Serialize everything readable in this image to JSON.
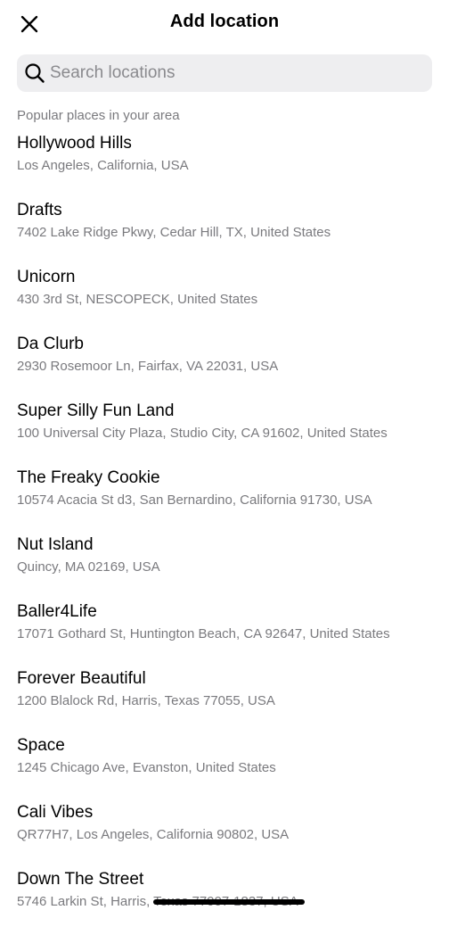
{
  "header": {
    "title": "Add location",
    "close_icon": "close-icon"
  },
  "search": {
    "placeholder": "Search locations",
    "value": "",
    "icon": "search-icon"
  },
  "section": {
    "title": "Popular places in your area"
  },
  "locations": [
    {
      "name": "Hollywood Hills",
      "address": "Los Angeles, California, USA"
    },
    {
      "name": "Drafts",
      "address": "7402 Lake Ridge Pkwy, Cedar Hill, TX, United States"
    },
    {
      "name": "Unicorn",
      "address": "430 3rd St, NESCOPECK, United States"
    },
    {
      "name": "Da Clurb",
      "address": "2930 Rosemoor Ln, Fairfax, VA 22031, USA"
    },
    {
      "name": "Super Silly Fun Land",
      "address": "100 Universal City Plaza, Studio City, CA 91602, United States"
    },
    {
      "name": "The Freaky Cookie",
      "address": "10574 Acacia St d3, San Bernardino, California 91730, USA"
    },
    {
      "name": "Nut Island",
      "address": "Quincy, MA 02169, USA"
    },
    {
      "name": "Baller4Life",
      "address": "17071 Gothard St, Huntington Beach, CA 92647, United States"
    },
    {
      "name": "Forever Beautiful",
      "address": "1200 Blalock Rd, Harris, Texas 77055, USA"
    },
    {
      "name": "Space",
      "address": "1245 Chicago Ave, Evanston, United States"
    },
    {
      "name": "Cali Vibes",
      "address": "QR77H7, Los Angeles, California 90802, USA"
    },
    {
      "name": "Down The Street",
      "address": "5746 Larkin St, Harris, Texas 77007-1837, USA"
    }
  ]
}
